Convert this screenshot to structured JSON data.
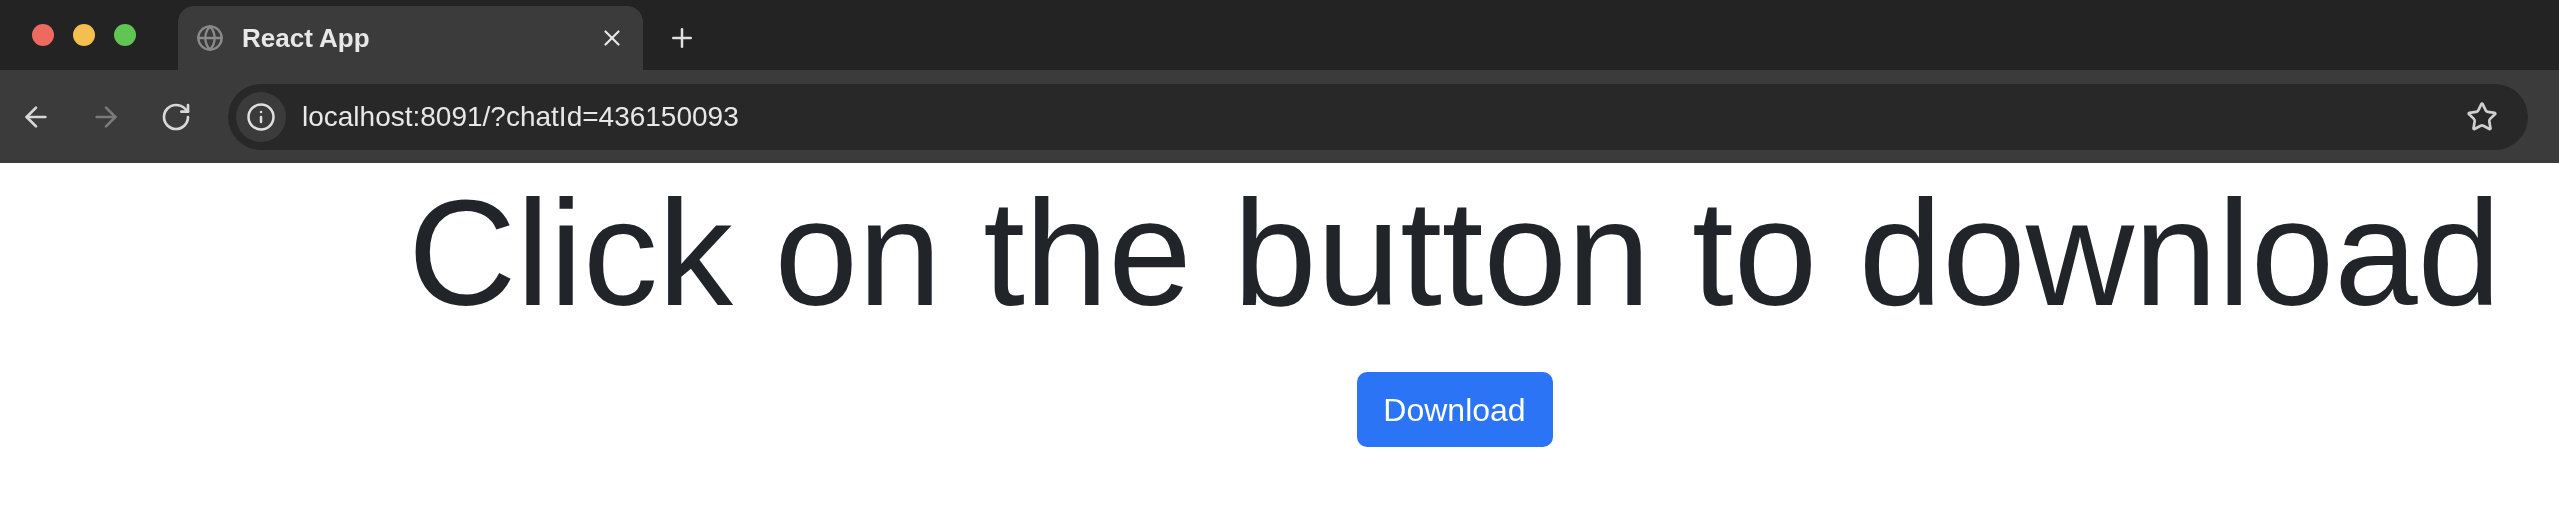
{
  "browser": {
    "tabs": [
      {
        "title": "React App",
        "selected": true
      }
    ],
    "nav_buttons": [
      {
        "kind": "back",
        "disabled": false
      },
      {
        "kind": "forward",
        "disabled": true
      },
      {
        "kind": "reload",
        "disabled": false
      }
    ],
    "address": "localhost:8091/?chatId=436150093"
  },
  "page": {
    "heading": "Click on the button to download",
    "button": "Download"
  }
}
